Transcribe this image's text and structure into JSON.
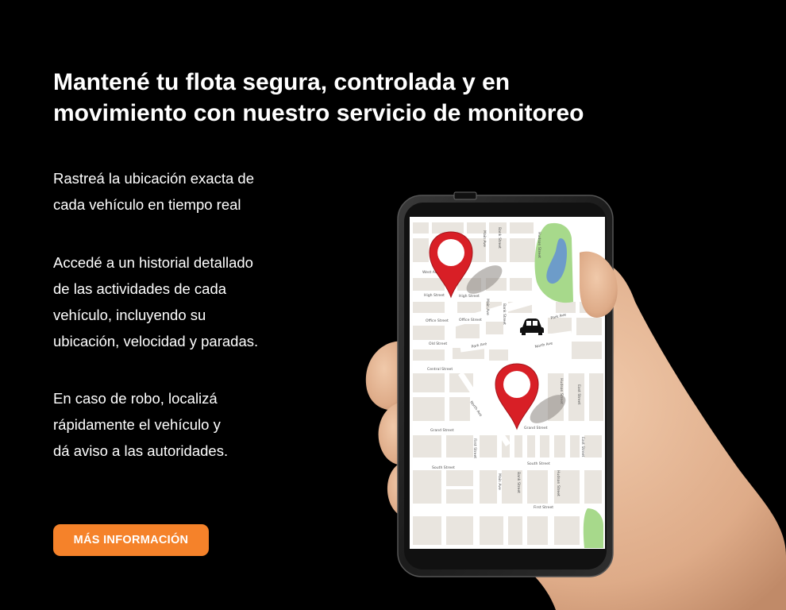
{
  "headline": {
    "line1": "Mantené tu flota segura, controlada y en",
    "line2": "movimiento con nuestro servicio de monitoreo"
  },
  "features": [
    {
      "lines": [
        "Rastreá la ubicación exacta de",
        "cada vehículo en tiempo real"
      ]
    },
    {
      "lines": [
        "Accedé a un historial detallado",
        "de las actividades de cada",
        "vehículo, incluyendo su",
        "ubicación, velocidad y paradas."
      ]
    },
    {
      "lines": [
        "En caso de robo, localizá",
        "rápidamente el vehículo y",
        "dá aviso a las autoridades."
      ]
    }
  ],
  "cta": {
    "label": "MÁS INFORMACIÓN"
  },
  "map": {
    "street_labels": {
      "west_ave": "West Ave",
      "high_street_1": "High Street",
      "high_street_2": "High Street",
      "office_street_1": "Office Street",
      "office_street_2": "Office Street",
      "old_street": "Old Street",
      "central_street": "Central Street",
      "park_ave_1": "Park Ave",
      "park_ave_2": "Park Ave",
      "north_ave_1": "North Ave",
      "north_ave_2": "North Ave",
      "grand_street_1": "Grand Street",
      "grand_street_2": "Grand Street",
      "first_street_1": "First Street",
      "first_street_2": "First Street",
      "south_street_1": "South Street",
      "south_street_2": "South Street",
      "main_ave_1": "Main Ave",
      "main_ave_2": "Main Ave",
      "main_ave_3": "Main Ave",
      "bank_street_1": "Bank Street",
      "bank_street_2": "Bank Street",
      "bank_street_3": "Bank Street",
      "hudson_street_1": "Hudson Street",
      "hudson_street_2": "Hudson Street",
      "hudson_street_3": "Hudson Street",
      "east_street_1": "East Street",
      "east_street_2": "East Street"
    },
    "icons": [
      "location-pin-icon",
      "location-pin-icon",
      "car-icon"
    ]
  },
  "colors": {
    "background": "#000000",
    "text": "#ffffff",
    "accent": "#f5822a",
    "pin": "#d81f26",
    "park": "#a7d98b",
    "water": "#6d9cc9"
  }
}
